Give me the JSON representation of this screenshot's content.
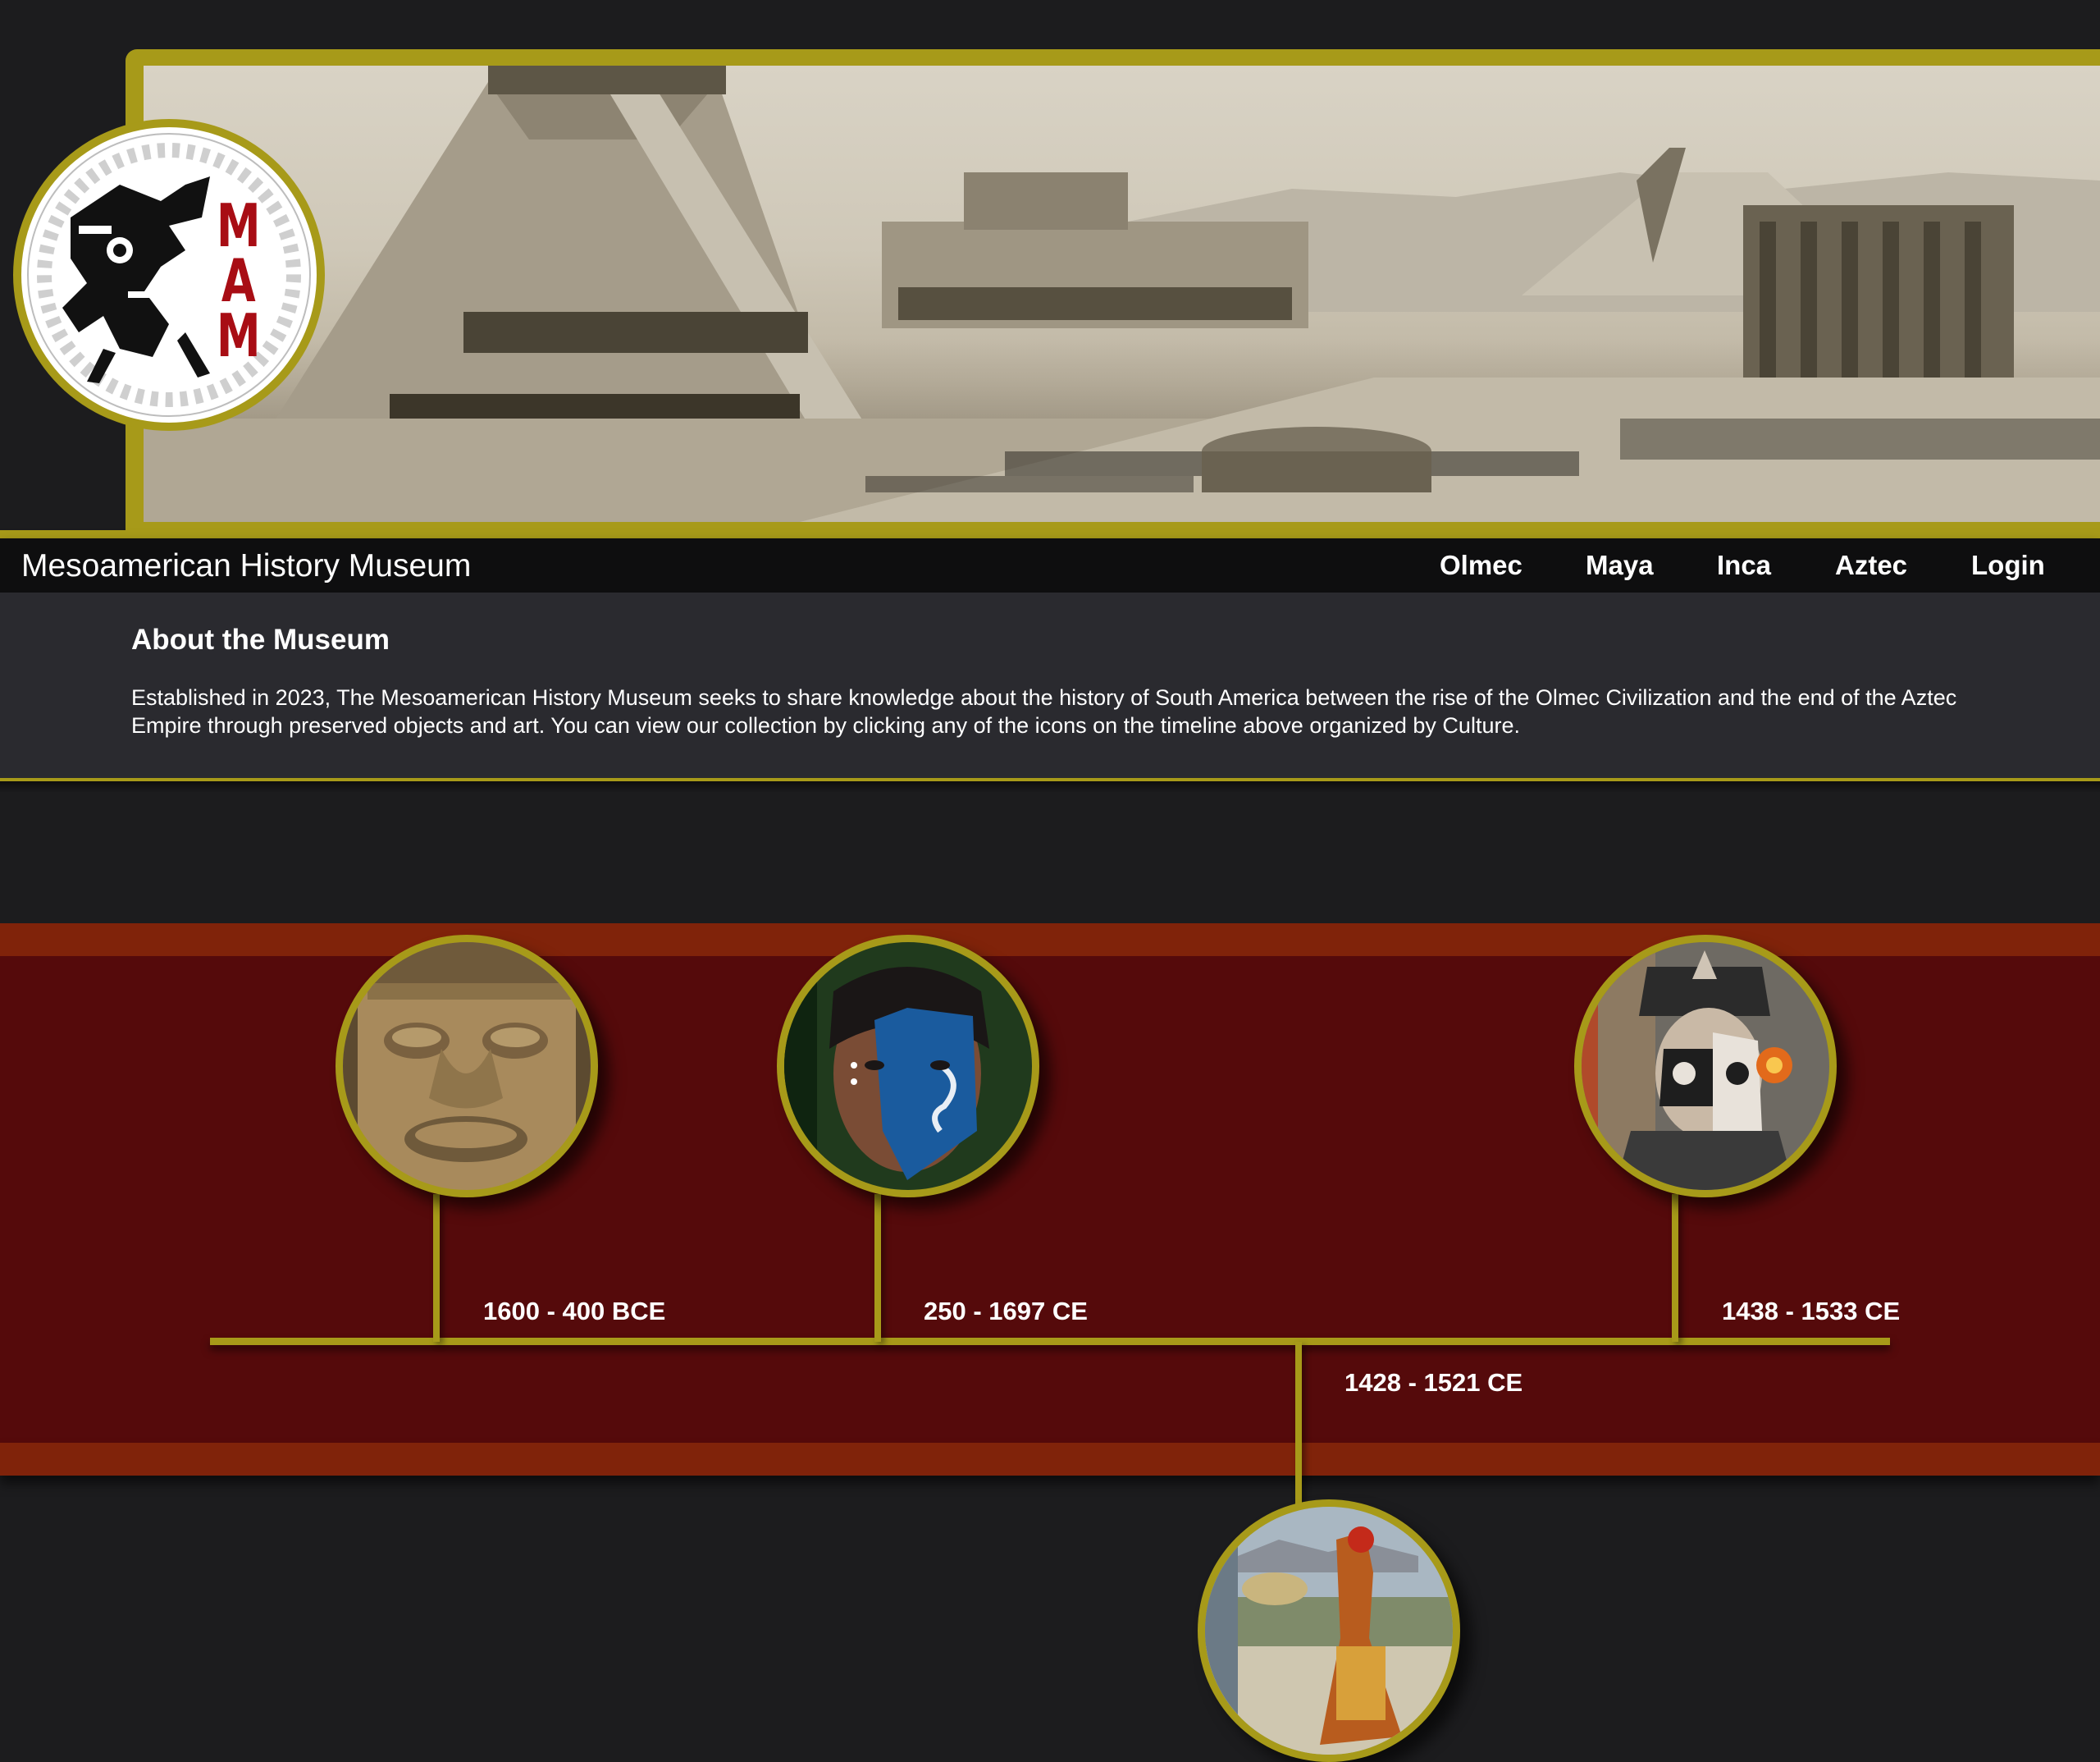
{
  "site": {
    "title": "Mesoamerican History Museum",
    "logo_text": "MAM"
  },
  "nav": {
    "items": [
      {
        "label": "Olmec"
      },
      {
        "label": "Maya"
      },
      {
        "label": "Inca"
      },
      {
        "label": "Aztec"
      },
      {
        "label": "Login"
      }
    ]
  },
  "about": {
    "heading": "About the Museum",
    "body": "Established in 2023, The Mesoamerican History Museum seeks to share knowledge about the history of South America between the rise of the Olmec Civilization and the end of the Aztec Empire through preserved objects and art. You can view our collection by clicking any of the icons on the timeline above organized by Culture."
  },
  "timeline": {
    "entries": [
      {
        "culture": "Olmec",
        "dates": "1600 - 400 BCE",
        "icon": "olmec-head-icon"
      },
      {
        "culture": "Maya",
        "dates": "250 - 1697 CE",
        "icon": "maya-face-paint-icon"
      },
      {
        "culture": "Inca",
        "dates": "1428 - 1521 CE",
        "icon": "inca-painting-icon"
      },
      {
        "culture": "Aztec",
        "dates": "1438 - 1533 CE",
        "icon": "aztec-dancer-icon"
      }
    ]
  },
  "colors": {
    "gold": "#a79a19",
    "band_dark": "#550a0b",
    "band_light": "#80230a",
    "background": "#1c1c1e",
    "logo_red": "#a80d14"
  }
}
